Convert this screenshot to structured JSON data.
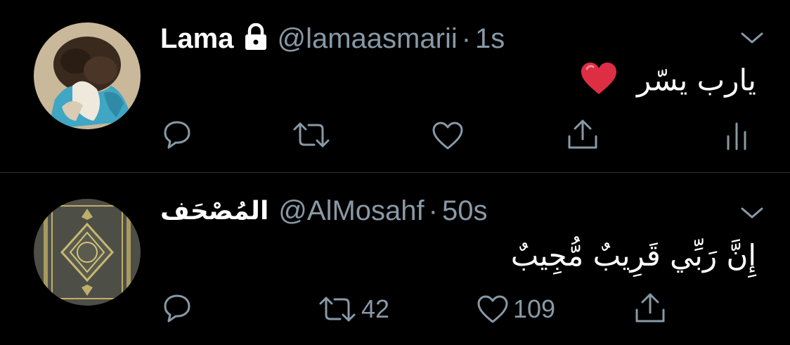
{
  "tweets": [
    {
      "name": "Lama",
      "handle": "@lamaasmarii",
      "separator": "·",
      "time": "1s",
      "protected": true,
      "text": "يارب يسّر",
      "emoji": "❤️",
      "actions": {
        "reply": "",
        "retweet": "",
        "like": "",
        "share": "",
        "analytics": ""
      }
    },
    {
      "name": "المُصْحَف",
      "handle": "@AlMosahf",
      "separator": "·",
      "time": "50s",
      "protected": false,
      "text": "إِنَّ رَبِّي قَرِيبٌ مُّجِيبٌ",
      "actions": {
        "reply": "",
        "retweet": "42",
        "like": "109",
        "share": ""
      }
    }
  ],
  "colors": {
    "background": "#000000",
    "text": "#ffffff",
    "secondary": "#8899a6",
    "divider": "#2f3336",
    "heart": "#e0245e"
  },
  "icons": [
    "lock-icon",
    "chevron-down-icon",
    "reply-icon",
    "retweet-icon",
    "like-icon",
    "share-icon",
    "analytics-icon"
  ]
}
